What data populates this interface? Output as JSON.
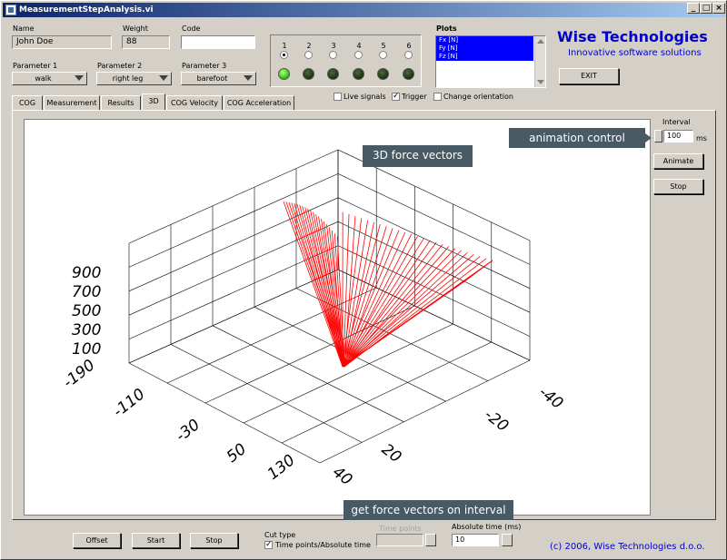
{
  "window": {
    "title": "MeasurementStepAnalysis.vi"
  },
  "fields": {
    "name_label": "Name",
    "name_value": "John Doe",
    "weight_label": "Weight",
    "weight_value": "88",
    "code_label": "Code",
    "code_value": ""
  },
  "parameters": [
    {
      "label": "Parameter 1",
      "value": "walk"
    },
    {
      "label": "Parameter 2",
      "value": "right leg"
    },
    {
      "label": "Parameter 3",
      "value": "barefoot"
    }
  ],
  "channels": {
    "labels": [
      "1",
      "2",
      "3",
      "4",
      "5",
      "6"
    ],
    "selected": 0,
    "led_on": [
      true,
      false,
      false,
      false,
      false,
      false
    ]
  },
  "plots": {
    "label": "Plots",
    "items": [
      "Fx [N]",
      "Fy [N]",
      "Fz [N]"
    ]
  },
  "brand": {
    "name": "Wise Technologies",
    "tagline": "Innovative software solutions"
  },
  "buttons": {
    "exit": "EXIT",
    "animate": "Animate",
    "stop_side": "Stop",
    "offset": "Offset",
    "start": "Start",
    "stop_bottom": "Stop"
  },
  "options": {
    "live_signals": {
      "label": "Live signals",
      "checked": false
    },
    "trigger": {
      "label": "Trigger",
      "checked": true
    },
    "change_orientation": {
      "label": "Change orientation",
      "checked": false
    }
  },
  "tabs": [
    "COG",
    "Measurement",
    "Results",
    "3D",
    "COG Velocity",
    "COG Acceleration"
  ],
  "active_tab": 3,
  "interval": {
    "label": "Interval",
    "value": "100",
    "unit": "ms"
  },
  "callouts": {
    "graph": "3D force vectors",
    "animation": "animation control",
    "cut": "get force vectors on interval"
  },
  "cut": {
    "type_label": "Cut type",
    "mode_label": "Time points/Absolute time",
    "mode_checked": true,
    "time_points_label": "Time points",
    "time_points_value": "",
    "abs_time_label": "Absolute time (ms)",
    "abs_time_value": "10"
  },
  "footer": "(c) 2006, Wise Technologies d.o.o.",
  "chart_data": {
    "type": "3d-vectors",
    "z_ticks": [
      "100",
      "300",
      "500",
      "700",
      "900"
    ],
    "x_ticks": [
      "-190",
      "-110",
      "-30",
      "50",
      "130"
    ],
    "y_ticks": [
      "40",
      "20",
      "-20",
      "-40"
    ],
    "vector_color": "#ff0000"
  },
  "colors": {
    "panel": "#d4d0c8",
    "brand": "#0000c8",
    "callout": "#485a63",
    "vectors": "#ff0000"
  }
}
